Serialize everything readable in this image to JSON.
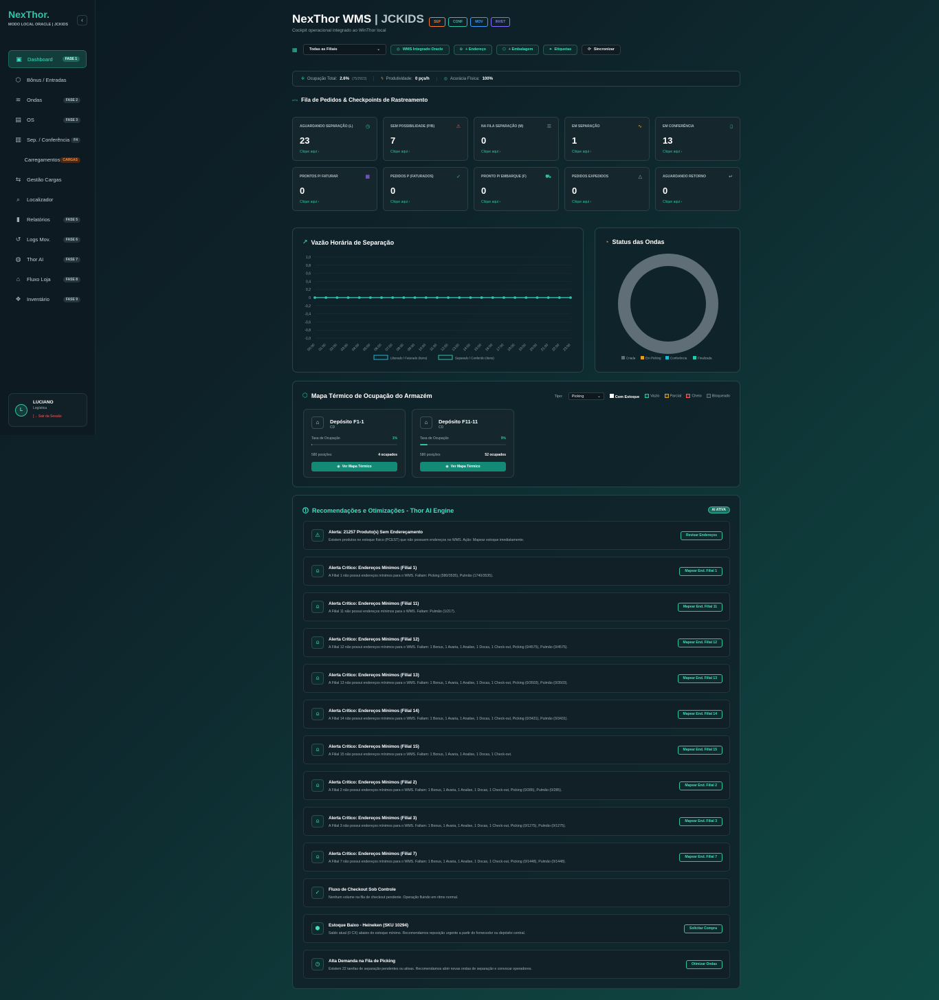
{
  "brand": {
    "name": "NexThor.",
    "subtitle": "MODO LOCAL ORACLE | JCKIDS"
  },
  "sidebar": {
    "items": [
      {
        "label": "Dashboard",
        "badge": "FASE 1",
        "icon": "dashboard-icon"
      },
      {
        "label": "Bônus / Entradas",
        "badge": "",
        "icon": "box-icon"
      },
      {
        "label": "Ondas",
        "badge": "FASE 2",
        "icon": "waves-icon"
      },
      {
        "label": "OS",
        "badge": "FASE 3",
        "icon": "document-icon"
      },
      {
        "label": "Sep. / Conferência",
        "badge": "F4",
        "icon": "columns-icon"
      },
      {
        "label": "Carregamentos",
        "badge": "CARGAS",
        "icon": ""
      },
      {
        "label": "Gestão Cargas",
        "badge": "",
        "icon": "transfer-icon"
      },
      {
        "label": "Localizador",
        "badge": "",
        "icon": "search-icon"
      },
      {
        "label": "Relatórios",
        "badge": "FASE 5",
        "icon": "bar-chart-icon"
      },
      {
        "label": "Logs Mov.",
        "badge": "FASE 6",
        "icon": "history-icon"
      },
      {
        "label": "Thor AI",
        "badge": "FASE 7",
        "icon": "ai-icon"
      },
      {
        "label": "Fluxo Loja",
        "badge": "FASE 8",
        "icon": "store-icon"
      },
      {
        "label": "Inventário",
        "badge": "FASE 9",
        "icon": "boxes-icon"
      }
    ]
  },
  "user": {
    "initial": "L",
    "name": "LUCIANO",
    "role": "Logística",
    "logout": "Sair da Sessão"
  },
  "header": {
    "title_main": "NexThor WMS",
    "title_sep": " | ",
    "title_client": "JCKIDS",
    "tags": [
      {
        "label": "SEP",
        "color": "#ff7a2f"
      },
      {
        "label": "CONF",
        "color": "#2ec4a8"
      },
      {
        "label": "MOV",
        "color": "#3aa0ff"
      },
      {
        "label": "INVET",
        "color": "#8a6cff"
      }
    ],
    "subtitle": "Cockpit operacional integrado ao WinThor local"
  },
  "toolbar": {
    "filial": "Todas as Filiais",
    "wms_oracle": "WMS Integrado Oracle",
    "endereco": "+ Endereço",
    "embalagem": "+ Embalagem",
    "etiquetas": "Etiquetas",
    "sincronizar": "Sincronizar"
  },
  "stats": {
    "ocupacao_label": "Ocupação Total:",
    "ocupacao_value": "2.6%",
    "ocupacao_detail": "(75/2923)",
    "produtividade_label": "Produtividade:",
    "produtividade_value": "0 pçs/h",
    "acuracia_label": "Acurácia Física:",
    "acuracia_value": "100%"
  },
  "queue": {
    "title": "Fila de Pedidos & Checkpoints de Rastreamento",
    "link_label": "Clique aqui",
    "cards": [
      {
        "title": "AGUARDANDO SEPARAÇÃO (L)",
        "value": "23",
        "icon": "clock-icon",
        "color": "#2ec4a8"
      },
      {
        "title": "SEM POSSIBILIDADE (P/B)",
        "value": "7",
        "icon": "warning-icon",
        "color": "#ff5a5a"
      },
      {
        "title": "NA FILA SEPARAÇÃO (M)",
        "value": "0",
        "icon": "list-icon",
        "color": "#3aa0ff"
      },
      {
        "title": "EM SEPARAÇÃO",
        "value": "1",
        "icon": "activity-icon",
        "color": "#ff9a2f"
      },
      {
        "title": "EM CONFERÊNCIA",
        "value": "13",
        "icon": "clipboard-icon",
        "color": "#2ec4a8"
      },
      {
        "title": "PRONTOS P/ FATURAR",
        "value": "0",
        "icon": "receipt-icon",
        "color": "#a06cff"
      },
      {
        "title": "PEDIDOS P (FATURADOS)",
        "value": "0",
        "icon": "check-circle-icon",
        "color": "#2ec4a8"
      },
      {
        "title": "PRONTO P/ EMBARQUE (F)",
        "value": "0",
        "icon": "truck-icon",
        "color": "#2ec4a8"
      },
      {
        "title": "PEDIDOS EXPEDIDOS",
        "value": "0",
        "icon": "send-icon",
        "color": "#9fb0b6"
      },
      {
        "title": "AGUARDANDO RETORNO",
        "value": "0",
        "icon": "return-icon",
        "color": "#9fb0b6"
      }
    ]
  },
  "charts": {
    "throughput_title": "Vazão Horária de Separação",
    "waves_title": "Status das Ondas"
  },
  "chart_data": [
    {
      "type": "line",
      "title": "Vazão Horária de Separação",
      "x": [
        "00:00",
        "01:00",
        "02:00",
        "03:00",
        "04:00",
        "05:00",
        "06:00",
        "07:00",
        "08:00",
        "09:00",
        "10:00",
        "11:00",
        "12:00",
        "13:00",
        "14:00",
        "15:00",
        "16:00",
        "17:00",
        "18:00",
        "19:00",
        "20:00",
        "21:00",
        "22:00",
        "23:00"
      ],
      "series": [
        {
          "name": "Liberado / Faturado (Itens)",
          "values": [
            0,
            0,
            0,
            0,
            0,
            0,
            0,
            0,
            0,
            0,
            0,
            0,
            0,
            0,
            0,
            0,
            0,
            0,
            0,
            0,
            0,
            0,
            0,
            0
          ],
          "color": "#1fb6d0"
        },
        {
          "name": "Separado / Conferido (Itens)",
          "values": [
            0,
            0,
            0,
            0,
            0,
            0,
            0,
            0,
            0,
            0,
            0,
            0,
            0,
            0,
            0,
            0,
            0,
            0,
            0,
            0,
            0,
            0,
            0,
            0
          ],
          "color": "#2ec4a8"
        }
      ],
      "yticks": [
        "1,0",
        "0,8",
        "0,6",
        "0,4",
        "0,2",
        "0",
        "-0,2",
        "-0,4",
        "-0,6",
        "-0,8",
        "-1,0"
      ],
      "ylim": [
        -1,
        1
      ],
      "grid": true,
      "legend": "bottom"
    },
    {
      "type": "pie",
      "title": "Status das Ondas",
      "donut": true,
      "labels": [
        "Criada",
        "Em Picking",
        "Conferência",
        "Finalizada"
      ],
      "values": [
        1,
        0,
        0,
        0
      ],
      "colors": [
        "#5f6e77",
        "#e0a020",
        "#1fb6d0",
        "#2ec4a8"
      ],
      "legend": "bottom"
    }
  ],
  "heatmap": {
    "title": "Mapa Térmico de Ocupação do Armazém",
    "tipo_label": "Tipo:",
    "tipo_value": "Picking",
    "com_estoque": "Com Estoque",
    "legend": [
      {
        "label": "Vazio",
        "color": "#2ec4a8"
      },
      {
        "label": "Parcial",
        "color": "#e0a020"
      },
      {
        "label": "Cheio",
        "color": "#ff5a5a"
      },
      {
        "label": "Bloqueado",
        "color": "#5f6e77"
      }
    ],
    "rate_label": "Taxa de Ocupação",
    "button_label": "Ver Mapa Térmico",
    "deposits": [
      {
        "name": "Depósito F1-1",
        "sub": "CD",
        "pct": "1%",
        "fill": 0.01,
        "positions": "580 posições",
        "occupied": "4 ocupados"
      },
      {
        "name": "Depósito F11-11",
        "sub": "CD",
        "pct": "9%",
        "fill": 0.09,
        "positions": "580 posições",
        "occupied": "52 ocupados"
      }
    ]
  },
  "ai": {
    "title": "Recomendações e Otimizações - Thor AI Engine",
    "badge": "AI ATIVA",
    "recs": [
      {
        "icon": "warning-icon",
        "title": "Alerta: 21257 Produto(s) Sem Endereçamento",
        "desc": "Existem produtos no estoque físico (PCEST) que não possuem endereços no WMS. Ação: Mapear estoque imediatamente.",
        "button": "Revisar Endereços"
      },
      {
        "icon": "siren-icon",
        "title": "Alerta Crítico: Endereços Mínimos (Filial 1)",
        "desc": "A Filial 1 não possui endereços mínimos para o WMS. Faltam: Picking (580/3535), Pulmão (1740/3535).",
        "button": "Mapear End. Filial 1"
      },
      {
        "icon": "siren-icon",
        "title": "Alerta Crítico: Endereços Mínimos (Filial 11)",
        "desc": "A Filial 11 não possui endereços mínimos para o WMS. Faltam: Pulmão (1/217).",
        "button": "Mapear End. Filial 11"
      },
      {
        "icon": "siren-icon",
        "title": "Alerta Crítico: Endereços Mínimos (Filial 12)",
        "desc": "A Filial 12 não possui endereços mínimos para o WMS. Faltam: 1 Bonus, 1 Avaria, 1 Analise, 1 Docas, 1 Check-out, Picking (0/4575), Pulmão (0/4575).",
        "button": "Mapear End. Filial 12"
      },
      {
        "icon": "siren-icon",
        "title": "Alerta Crítico: Endereços Mínimos (Filial 13)",
        "desc": "A Filial 13 não possui endereços mínimos para o WMS. Faltam: 1 Bonus, 1 Avaria, 1 Analise, 1 Docas, 1 Check-out, Picking (0/3503), Pulmão (0/3503).",
        "button": "Mapear End. Filial 13"
      },
      {
        "icon": "siren-icon",
        "title": "Alerta Crítico: Endereços Mínimos (Filial 14)",
        "desc": "A Filial 14 não possui endereços mínimos para o WMS. Faltam: 1 Bonus, 1 Avaria, 1 Analise, 1 Docas, 1 Check-out, Picking (0/3431), Pulmão (0/3431).",
        "button": "Mapear End. Filial 14"
      },
      {
        "icon": "siren-icon",
        "title": "Alerta Crítico: Endereços Mínimos (Filial 15)",
        "desc": "A Filial 15 não possui endereços mínimos para o WMS. Faltam: 1 Bonus, 1 Avaria, 1 Analise, 1 Docas, 1 Check-out.",
        "button": "Mapear End. Filial 15"
      },
      {
        "icon": "siren-icon",
        "title": "Alerta Crítico: Endereços Mínimos (Filial 2)",
        "desc": "A Filial 2 não possui endereços mínimos para o WMS. Faltam: 1 Bonus, 1 Avaria, 1 Analise, 1 Docas, 1 Check-out, Picking (0/285), Pulmão (0/285).",
        "button": "Mapear End. Filial 2"
      },
      {
        "icon": "siren-icon",
        "title": "Alerta Crítico: Endereços Mínimos (Filial 3)",
        "desc": "A Filial 3 não possui endereços mínimos para o WMS. Faltam: 1 Bonus, 1 Avaria, 1 Analise, 1 Docas, 1 Check-out, Picking (0/1275), Pulmão (0/1275).",
        "button": "Mapear End. Filial 3"
      },
      {
        "icon": "siren-icon",
        "title": "Alerta Crítico: Endereços Mínimos (Filial 7)",
        "desc": "A Filial 7 não possui endereços mínimos para o WMS. Faltam: 1 Bonus, 1 Avaria, 1 Analise, 1 Docas, 1 Check-out, Picking (0/1448), Pulmão (0/1448).",
        "button": "Mapear End. Filial 7"
      },
      {
        "icon": "check-circle-icon",
        "title": "Fluxo de Checkout Sob Controle",
        "desc": "Nenhum volume na fila de checkout pendente. Operação fluindo em ritmo normal.",
        "button": ""
      },
      {
        "icon": "package-icon",
        "title": "Estoque Baixo - Heineken (SKU 10294)",
        "desc": "Saldo atual (0 CX) abaixo do estoque mínimo. Recomendamos reposição urgente a partir do fornecedor ou depósito central.",
        "button": "Solicitar Compra"
      },
      {
        "icon": "clock-icon",
        "title": "Alta Demanda na Fila de Picking",
        "desc": "Existem 22 tarefas de separação pendentes ou ativas. Recomendamos abrir novas ondas de separação e convocar operadores.",
        "button": "Otimizar Ondas"
      }
    ]
  }
}
